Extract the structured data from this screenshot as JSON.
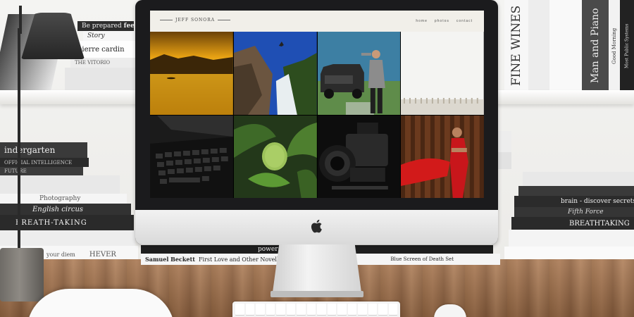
{
  "shelf_books_left_top": [
    "Be prepared",
    "feel secure",
    "Story",
    "pierre cardin",
    "THE VITORIO"
  ],
  "shelf_books_left_bottom": [
    "indergarten",
    "OFFICIAL INTELLIGENCE",
    "FUTURE",
    "Photography",
    "English circus",
    "BREATH-TAKING",
    "your diem",
    "HEVER"
  ],
  "shelf_books_right_top": [
    "FINE WINES",
    "Man and Piano",
    "Good Morning",
    "Most Public Systems"
  ],
  "shelf_books_right_bottom": [
    "brain - discover secrets",
    "Fifth Force",
    "BREATHTAKING",
    "Blue Screen of Death"
  ],
  "desk_books": [
    "Samuel Beckett",
    "First Love and Other Novellas",
    "power of carnival",
    "Blue Screen of Death Set"
  ],
  "website": {
    "logo": "JEFF SONORA",
    "nav": [
      "home",
      "photos",
      "contact"
    ]
  },
  "gallery": [
    {
      "subject": "sunset-lake"
    },
    {
      "subject": "waterfall-jump"
    },
    {
      "subject": "man-with-suv"
    },
    {
      "subject": "misty-field"
    },
    {
      "subject": "laptop-keyboard"
    },
    {
      "subject": "custard-apple"
    },
    {
      "subject": "cinema-camera"
    },
    {
      "subject": "woman-red-dress"
    }
  ],
  "colors": {
    "site_background": "#f1efe9",
    "imac_bezel": "#1b1b1d",
    "desk_wood": "#9a6b45"
  }
}
